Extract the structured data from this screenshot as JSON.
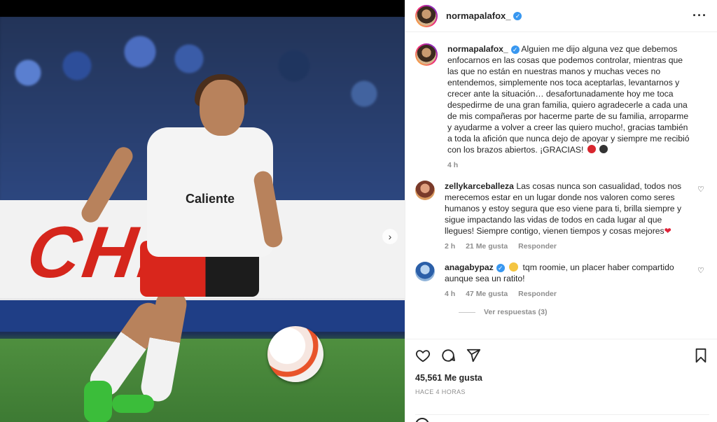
{
  "post": {
    "username": "normapalafox_",
    "caption": "Alguien me dijo alguna vez que debemos enfocarnos en las cosas que podemos controlar, mientras que las que no están en nuestras manos y muchas veces no entendemos, simplemente nos toca aceptarlas, levantarnos y crecer ante la situación… desafortunadamente hoy me toca despedirme de una gran familia, quiero agradecerle a cada una de mis compañeras por hacerme parte de su familia, arroparme y ayudarme a volver a creer las quiero mucho!, gracias también a toda la afición que nunca dejo de apoyar y siempre me recibió con los brazos abiertos. ¡GRACIAS!",
    "caption_time": "4 h",
    "likes": "45,561 Me gusta",
    "posted": "HACE 4 HORAS"
  },
  "photo": {
    "banner_text": "CHIVA",
    "shirt_text": "Caliente"
  },
  "comments": [
    {
      "username": "zellykarceballeza",
      "text": "Las cosas nunca son casualidad, todos nos merecemos estar en un lugar donde nos valoren como seres humanos y estoy segura que eso viene para ti, brilla siempre y sigue impactando las vidas de todos en cada lugar al que llegues! Siempre contigo, vienen tiempos y cosas mejores",
      "time": "2 h",
      "likes": "21 Me gusta",
      "reply": "Responder"
    },
    {
      "username": "anagabypaz",
      "text": "tqm roomie, un placer haber compartido aunque sea un ratito!",
      "time": "4 h",
      "likes": "47 Me gusta",
      "reply": "Responder",
      "view_replies": "Ver respuestas (3)"
    }
  ],
  "icons": {
    "like": "heart-icon",
    "comment": "comment-icon",
    "share": "share-icon",
    "save": "bookmark-icon",
    "more": "more-icon",
    "verified": "verified-badge-icon"
  },
  "colors": {
    "verified": "#3897f0",
    "muted": "#8e8e8e",
    "text": "#262626",
    "heart_emoji": "#e0243a"
  }
}
